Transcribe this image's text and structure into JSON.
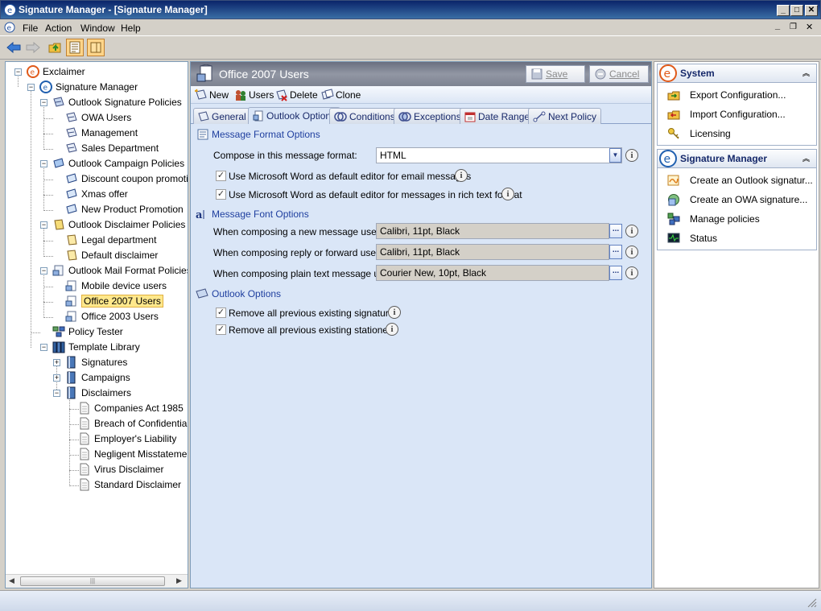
{
  "window": {
    "title": "Signature Manager - [Signature Manager]"
  },
  "menu": [
    "File",
    "Action",
    "Window",
    "Help"
  ],
  "tree": {
    "root": "Exclaimer",
    "signature_manager": "Signature Manager",
    "outlook_signature_policies": "Outlook Signature Policies",
    "owa_users": "OWA Users",
    "management": "Management",
    "sales_department": "Sales Department",
    "outlook_campaign_policies": "Outlook Campaign Policies",
    "discount_coupon_promotion": "Discount coupon promotion",
    "xmas_offer": "Xmas offer",
    "new_product_promotion": "New Product Promotion",
    "outlook_disclaimer_policies": "Outlook Disclaimer Policies",
    "legal_department": "Legal department",
    "default_disclaimer": "Default disclaimer",
    "outlook_mail_format_policies": "Outlook Mail Format Policies",
    "mobile_device_users": "Mobile device users",
    "office_2007_users": "Office 2007 Users",
    "office_2003_users": "Office 2003 Users",
    "policy_tester": "Policy Tester",
    "template_library": "Template Library",
    "signatures": "Signatures",
    "campaigns": "Campaigns",
    "disclaimers": "Disclaimers",
    "companies_act": "Companies Act 1985",
    "breach": "Breach of Confidentiality",
    "employers_liability": "Employer's Liability",
    "negligent": "Negligent Misstatement",
    "virus": "Virus Disclaimer",
    "standard": "Standard Disclaimer"
  },
  "center": {
    "title": "Office 2007 Users",
    "save": "Save",
    "cancel": "Cancel",
    "actions": {
      "new": "New",
      "users": "Users",
      "delete": "Delete",
      "clone": "Clone"
    },
    "tabs": {
      "general": "General",
      "outlook_options": "Outlook Options",
      "conditions": "Conditions",
      "exceptions": "Exceptions",
      "date_range": "Date Range",
      "next_policy": "Next Policy"
    },
    "format_section": "Message Format Options",
    "compose_label": "Compose in this message format:",
    "compose_value": "HTML",
    "use_word_email": "Use Microsoft Word as default editor for email messages",
    "use_word_rtf": "Use Microsoft Word as default editor for messages in rich text format",
    "font_section": "Message Font Options",
    "new_message_label": "When composing a new message use",
    "new_message_value": "Calibri, 11pt,  Black",
    "reply_label": "When composing reply or forward use",
    "reply_value": "Calibri, 11pt,  Black",
    "plain_label": "When composing plain text message use",
    "plain_value": "Courier New, 10pt,  Black",
    "outlook_section": "Outlook Options",
    "remove_signatures": "Remove all previous existing signatures",
    "remove_stationery": "Remove all previous existing stationery"
  },
  "right": {
    "system_title": "System",
    "export": "Export Configuration...",
    "import": "Import Configuration...",
    "licensing": "Licensing",
    "sm_title": "Signature Manager",
    "create_outlook": "Create an Outlook signatur...",
    "create_owa": "Create an OWA signature...",
    "manage": "Manage policies",
    "status": "Status"
  }
}
